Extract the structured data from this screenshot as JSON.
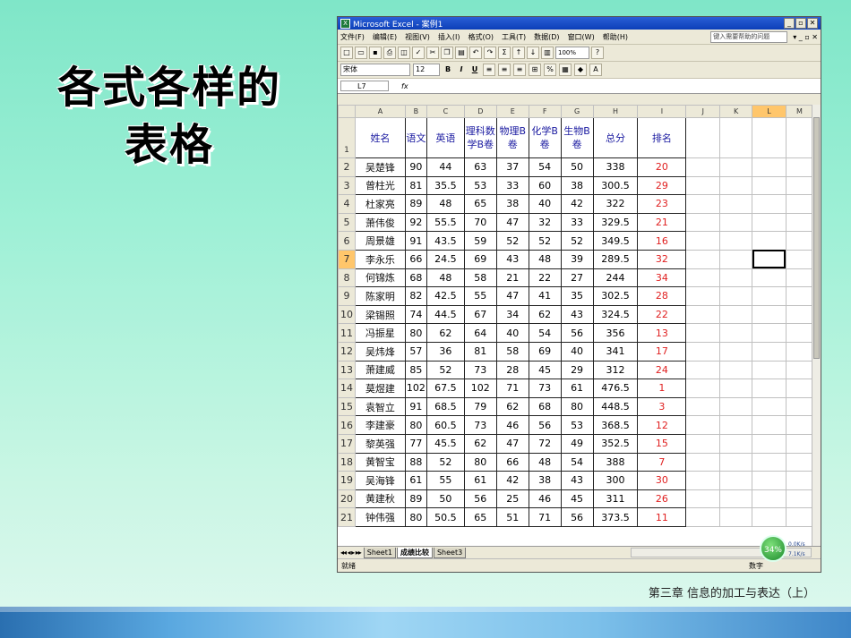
{
  "slide": {
    "title": "各式各样的表格",
    "footer": "第三章 信息的加工与表达（上）"
  },
  "excel": {
    "window_title": "Microsoft Excel - 案例1",
    "menu": [
      "文件(F)",
      "编辑(E)",
      "视图(V)",
      "插入(I)",
      "格式(O)",
      "工具(T)",
      "数据(D)",
      "窗口(W)",
      "帮助(H)"
    ],
    "help_placeholder": "键入需要帮助的问题",
    "zoom": "100%",
    "font": "宋体",
    "font_size": "12",
    "name_box": "L7",
    "fx": "fx",
    "columns": [
      "A",
      "B",
      "C",
      "D",
      "E",
      "F",
      "G",
      "H",
      "I",
      "J",
      "K",
      "L",
      "M"
    ],
    "header_row": [
      "姓名",
      "语文",
      "英语",
      "理科数学B卷",
      "物理B卷",
      "化学B卷",
      "生物B卷",
      "总分",
      "排名"
    ],
    "rows": [
      [
        "吴楚锋",
        "90",
        "44",
        "63",
        "37",
        "54",
        "50",
        "338",
        "20"
      ],
      [
        "曾柱光",
        "81",
        "35.5",
        "53",
        "33",
        "60",
        "38",
        "300.5",
        "29"
      ],
      [
        "杜家亮",
        "89",
        "48",
        "65",
        "38",
        "40",
        "42",
        "322",
        "23"
      ],
      [
        "萧伟俊",
        "92",
        "55.5",
        "70",
        "47",
        "32",
        "33",
        "329.5",
        "21"
      ],
      [
        "周景雄",
        "91",
        "43.5",
        "59",
        "52",
        "52",
        "52",
        "349.5",
        "16"
      ],
      [
        "李永乐",
        "66",
        "24.5",
        "69",
        "43",
        "48",
        "39",
        "289.5",
        "32"
      ],
      [
        "何锦炼",
        "68",
        "48",
        "58",
        "21",
        "22",
        "27",
        "244",
        "34"
      ],
      [
        "陈家明",
        "82",
        "42.5",
        "55",
        "47",
        "41",
        "35",
        "302.5",
        "28"
      ],
      [
        "梁锡照",
        "74",
        "44.5",
        "67",
        "34",
        "62",
        "43",
        "324.5",
        "22"
      ],
      [
        "冯振星",
        "80",
        "62",
        "64",
        "40",
        "54",
        "56",
        "356",
        "13"
      ],
      [
        "吴炜烽",
        "57",
        "36",
        "81",
        "58",
        "69",
        "40",
        "341",
        "17"
      ],
      [
        "萧建威",
        "85",
        "52",
        "73",
        "28",
        "45",
        "29",
        "312",
        "24"
      ],
      [
        "莫煜建",
        "102",
        "67.5",
        "102",
        "71",
        "73",
        "61",
        "476.5",
        "1"
      ],
      [
        "袁智立",
        "91",
        "68.5",
        "79",
        "62",
        "68",
        "80",
        "448.5",
        "3"
      ],
      [
        "李建豪",
        "80",
        "60.5",
        "73",
        "46",
        "56",
        "53",
        "368.5",
        "12"
      ],
      [
        "黎英强",
        "77",
        "45.5",
        "62",
        "47",
        "72",
        "49",
        "352.5",
        "15"
      ],
      [
        "黄智宝",
        "88",
        "52",
        "80",
        "66",
        "48",
        "54",
        "388",
        "7"
      ],
      [
        "吴海锋",
        "61",
        "55",
        "61",
        "42",
        "38",
        "43",
        "300",
        "30"
      ],
      [
        "黄建秋",
        "89",
        "50",
        "56",
        "25",
        "46",
        "45",
        "311",
        "26"
      ],
      [
        "钟伟强",
        "80",
        "50.5",
        "65",
        "51",
        "71",
        "56",
        "373.5",
        "11"
      ]
    ],
    "sheet_tabs": [
      "Sheet1",
      "成绩比较",
      "Sheet3"
    ],
    "status_left": "就绪",
    "status_num": "数字",
    "net_percent": "34%",
    "net_up": "0.0K/s",
    "net_down": "7.1K/s"
  }
}
